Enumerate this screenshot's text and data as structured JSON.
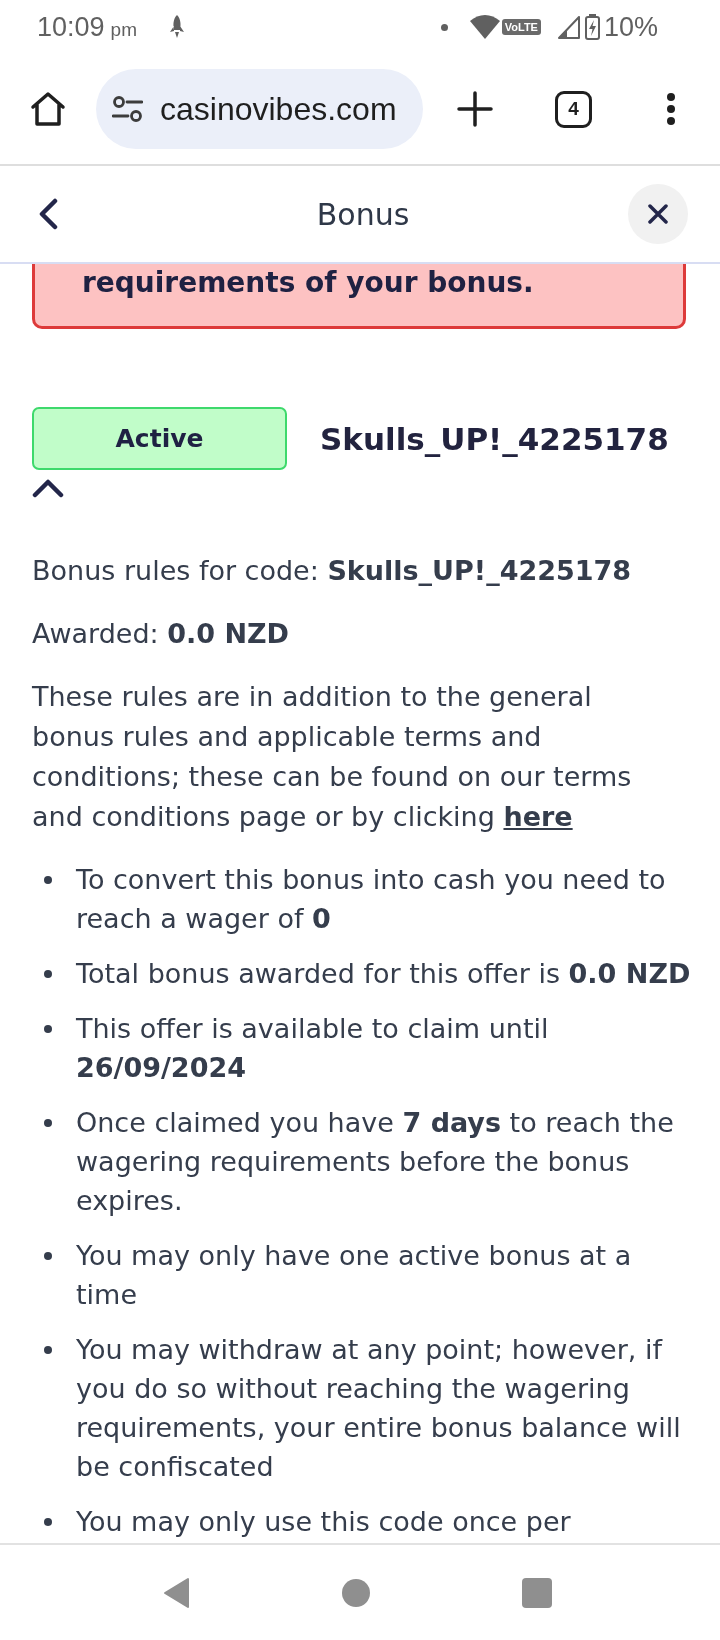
{
  "status_bar": {
    "time": "10:09",
    "time_suffix": "pm",
    "network_badge": "VoLTE",
    "battery": "10%"
  },
  "browser": {
    "url": "casinovibes.com",
    "tab_count": "4"
  },
  "header": {
    "title": "Bonus"
  },
  "alert": {
    "kind": "error",
    "text": "requirements of your bonus."
  },
  "bonus": {
    "status": {
      "label": "Active",
      "kind": "active"
    },
    "code": "Skulls_UP!_4225178",
    "expanded": true,
    "rules_line": "Bonus rules for code: **Skulls_UP!_4225178**",
    "awarded": "Awarded: **0.0 NZD**",
    "intro": "These rules are in addition to the general bonus rules and applicable terms and conditions; these can be found on our terms and conditions page or by clicking",
    "link": "here",
    "rules": [
      "To convert this bonus into cash you need to reach a wager of **0**",
      "Total bonus awarded for this offer is **0.0 NZD**",
      "This offer is available to claim until **26/09/2024**",
      "Once claimed you have **7 days** to reach the wagering requirements before the bonus expires.",
      "You may only have one active bonus at a time",
      "You may withdraw at any point; however, if you do so without reaching the wagering requirements, your entire bonus balance will be confiscated",
      "You may only use this code once per"
    ]
  }
}
